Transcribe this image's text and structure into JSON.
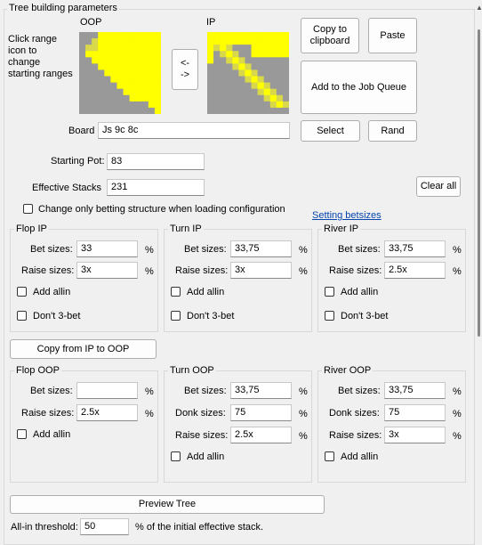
{
  "title": "Tree building parameters",
  "ranges": {
    "hint": [
      "Click range",
      "icon to",
      "change",
      "starting ranges"
    ],
    "oop_label": "OOP",
    "ip_label": "IP",
    "swap_label": [
      "<-",
      "->"
    ]
  },
  "buttons": {
    "copy_clipboard": [
      "Copy to",
      "clipboard"
    ],
    "paste": "Paste",
    "add_job_queue": "Add to the Job Queue",
    "select": "Select",
    "rand": "Rand",
    "clear_all": "Clear all",
    "copy_ip_oop": "Copy from IP to OOP",
    "preview_tree": "Preview Tree"
  },
  "board": {
    "label": "Board",
    "value": "Js 9c 8c"
  },
  "starting_pot": {
    "label": "Starting Pot:",
    "value": "83"
  },
  "effective_stacks": {
    "label": "Effective Stacks",
    "value": "231"
  },
  "change_only_betting": {
    "label": "Change only betting structure when loading configuration",
    "checked": false
  },
  "setting_betsizes_link": "Setting betsizes",
  "flop_ip": {
    "title": "Flop IP",
    "bet_label": "Bet sizes:",
    "bet_value": "33",
    "raise_label": "Raise sizes:",
    "raise_value": "3x",
    "add_allin": "Add allin",
    "dont_3bet": "Don't 3-bet"
  },
  "turn_ip": {
    "title": "Turn IP",
    "bet_label": "Bet sizes:",
    "bet_value": "33,75",
    "raise_label": "Raise sizes:",
    "raise_value": "3x",
    "add_allin": "Add allin",
    "dont_3bet": "Don't 3-bet"
  },
  "river_ip": {
    "title": "River IP",
    "bet_label": "Bet sizes:",
    "bet_value": "33,75",
    "raise_label": "Raise sizes:",
    "raise_value": "2.5x",
    "add_allin": "Add allin",
    "dont_3bet": "Don't 3-bet"
  },
  "flop_oop": {
    "title": "Flop OOP",
    "bet_label": "Bet sizes:",
    "bet_value": "",
    "raise_label": "Raise sizes:",
    "raise_value": "2.5x",
    "add_allin": "Add allin"
  },
  "turn_oop": {
    "title": "Turn OOP",
    "bet_label": "Bet sizes:",
    "bet_value": "33,75",
    "donk_label": "Donk sizes:",
    "donk_value": "75",
    "raise_label": "Raise sizes:",
    "raise_value": "2.5x",
    "add_allin": "Add allin"
  },
  "river_oop": {
    "title": "River OOP",
    "bet_label": "Bet sizes:",
    "bet_value": "33,75",
    "donk_label": "Donk sizes:",
    "donk_value": "75",
    "raise_label": "Raise sizes:",
    "raise_value": "3x",
    "add_allin": "Add allin"
  },
  "percent": "%",
  "allin_threshold": {
    "label": "All-in threshold:",
    "value": "50",
    "suffix": "% of the initial effective stack."
  },
  "colors": {
    "range_fill": "#ffff00",
    "range_empty": "#999999",
    "link": "#0645ad"
  }
}
